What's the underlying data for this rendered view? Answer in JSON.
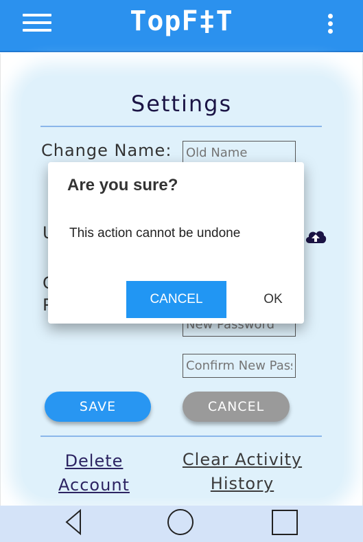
{
  "appbar": {
    "title": "TopF‡T",
    "background": "#2b91ee",
    "menu_icon": "hamburger-menu-icon",
    "overflow_icon": "more-vert-icon"
  },
  "settings": {
    "title": "Settings",
    "change_name_label": "Change Name:",
    "old_name_placeholder": "Old Name",
    "upload_label": "U",
    "password_label_line1": "C",
    "password_label_line2": "P",
    "new_password_placeholder": "New Password",
    "confirm_password_placeholder": "Confirm New Password",
    "upload_icon": "cloud-upload-icon",
    "save_label": "SAVE",
    "cancel_label": "CANCEL",
    "delete_account_line1": "Delete ",
    "delete_account_line2": "Account",
    "clear_history_line1": "Clear Activity",
    "clear_history_line2": "History"
  },
  "dialog": {
    "title": "Are you sure?",
    "message": "This action cannot be undone",
    "cancel_label": "CANCEL",
    "ok_label": "OK",
    "accent": "#2196f3"
  },
  "navbar": {
    "back_icon": "back-triangle-icon",
    "home_icon": "home-circle-icon",
    "recent_icon": "recent-apps-square-icon"
  }
}
